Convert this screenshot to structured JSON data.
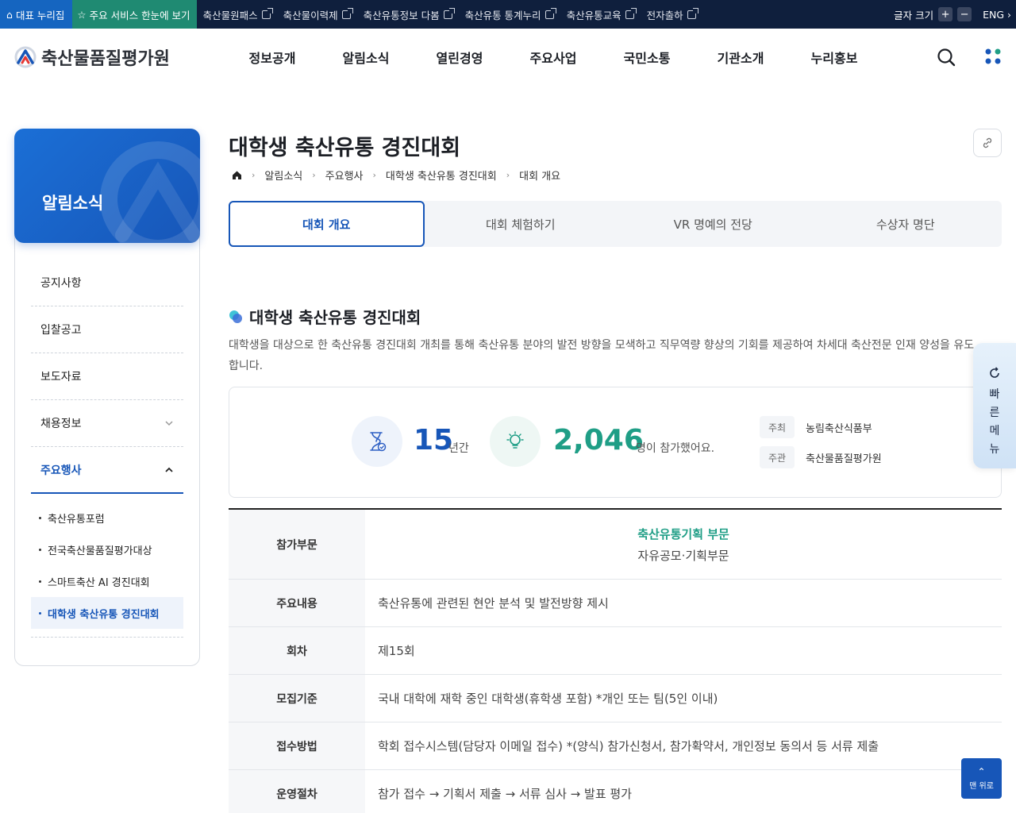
{
  "topbar": {
    "home_label": "대표 누리집",
    "star_label": "주요 서비스 한눈에 보기",
    "links": [
      "축산물원패스",
      "축산물이력제",
      "축산유통정보 다봄",
      "축산유통 통계누리",
      "축산유통교육",
      "전자출하"
    ],
    "font_size_label": "글자 크기",
    "plus": "+",
    "minus": "−",
    "lang_label": "ENG"
  },
  "header": {
    "logo_text": "축산물품질평가원",
    "nav": [
      "정보공개",
      "알림소식",
      "열린경영",
      "주요사업",
      "국민소통",
      "기관소개",
      "누리홍보"
    ]
  },
  "sidebar": {
    "title": "알림소식",
    "items": [
      {
        "label": "공지사항"
      },
      {
        "label": "입찰공고"
      },
      {
        "label": "보도자료"
      },
      {
        "label": "채용정보"
      },
      {
        "label": "주요행사"
      }
    ],
    "sub_items": [
      "축산유통포럼",
      "전국축산물품질평가대상",
      "스마트축산 AI 경진대회",
      "대학생 축산유통 경진대회"
    ]
  },
  "page": {
    "title": "대학생 축산유통 경진대회",
    "breadcrumb": [
      "알림소식",
      "주요행사",
      "대학생 축산유통 경진대회",
      "대회 개요"
    ],
    "tabs": [
      "대회 개요",
      "대회 체험하기",
      "VR 명예의 전당",
      "수상자 명단"
    ],
    "section_title": "대학생 축산유통 경진대회",
    "section_desc": "대학생을 대상으로 한 축산유통 경진대회 개최를 통해 축산유통 분야의 발전 방향을 모색하고 직무역량 향상의 기회를 제공하여 차세대 축산전문 인재 양성을 유도합니다."
  },
  "stats": {
    "years_num": "15",
    "years_unit": "년간",
    "participants_num": "2,046",
    "participants_unit": "명이 참가했어요.",
    "host_label": "주최",
    "host_value": "농림축산식품부",
    "organizer_label": "주관",
    "organizer_value": "축산물품질평가원"
  },
  "table": {
    "rows": [
      {
        "th": "참가부문",
        "highlight": "축산유통기획 부문",
        "td": "자유공모·기획부문"
      },
      {
        "th": "주요내용",
        "td": "축산유통에 관련된 현안 분석 및 발전방향 제시"
      },
      {
        "th": "회차",
        "td": "제15회"
      },
      {
        "th": "모집기준",
        "td": "국내 대학에 재학 중인 대학생(휴학생 포함) *개인 또는 팀(5인 이내)"
      },
      {
        "th": "접수방법",
        "td": "학회 접수시스템(담당자 이메일 접수) *(양식) 참가신청서, 참가확약서, 개인정보 동의서 등 서류 제출"
      },
      {
        "th": "운영절차",
        "td": "참가 접수 → 기획서 제출 → 서류 심사 → 발표 평가"
      }
    ]
  },
  "quick_menu": {
    "label": [
      "빠",
      "른",
      "메",
      "뉴"
    ]
  },
  "top_button": {
    "label": "맨 위로"
  },
  "colors": {
    "primary": "#1756b8",
    "accent": "#1f9e86",
    "topbar": "#0f1f3d"
  }
}
